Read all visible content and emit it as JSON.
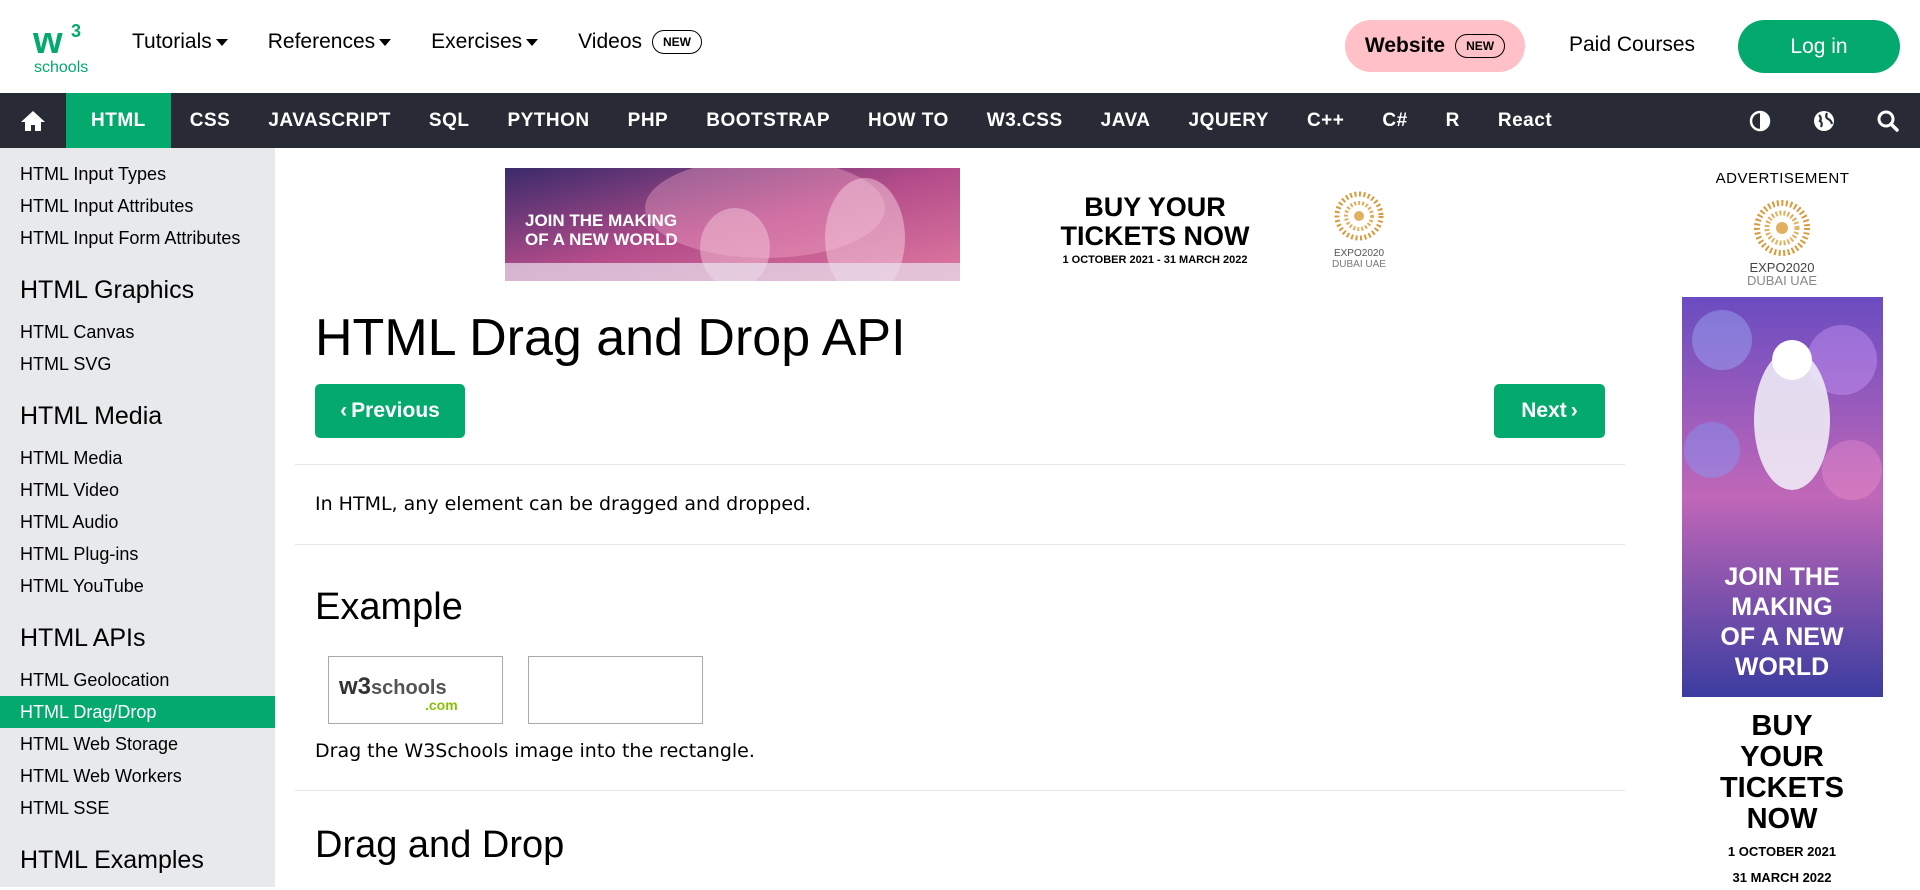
{
  "topnav": {
    "items": [
      {
        "label": "Tutorials"
      },
      {
        "label": "References"
      },
      {
        "label": "Exercises"
      },
      {
        "label": "Videos",
        "badge": "NEW"
      }
    ],
    "website": {
      "label": "Website",
      "badge": "NEW"
    },
    "paid_courses": "Paid Courses",
    "login": "Log in",
    "logo_text": "schools"
  },
  "darknav": {
    "tabs": [
      "HTML",
      "CSS",
      "JAVASCRIPT",
      "SQL",
      "PYTHON",
      "PHP",
      "BOOTSTRAP",
      "HOW TO",
      "W3.CSS",
      "JAVA",
      "JQUERY",
      "C++",
      "C#",
      "R",
      "React"
    ],
    "active": "HTML"
  },
  "sidebar": {
    "links_top": [
      "HTML Input Types",
      "HTML Input Attributes",
      "HTML Input Form Attributes"
    ],
    "sections": [
      {
        "heading": "HTML Graphics",
        "links": [
          "HTML Canvas",
          "HTML SVG"
        ]
      },
      {
        "heading": "HTML Media",
        "links": [
          "HTML Media",
          "HTML Video",
          "HTML Audio",
          "HTML Plug-ins",
          "HTML YouTube"
        ]
      },
      {
        "heading": "HTML APIs",
        "links": [
          "HTML Geolocation",
          "HTML Drag/Drop",
          "HTML Web Storage",
          "HTML Web Workers",
          "HTML SSE"
        ]
      },
      {
        "heading": "HTML Examples",
        "links": []
      }
    ],
    "active_link": "HTML Drag/Drop"
  },
  "banner": {
    "left_text": "JOIN THE MAKING OF A NEW WORLD",
    "headline": "BUY YOUR TICKETS NOW",
    "dates": "1 OCTOBER 2021 - 31 MARCH 2022",
    "expo": "EXPO2020",
    "expo_sub": "DUBAI UAE"
  },
  "main": {
    "title": "HTML Drag and Drop API",
    "prev": "Previous",
    "next": "Next",
    "intro": "In HTML, any element can be dragged and dropped.",
    "example_heading": "Example",
    "drag_caption": "Drag the W3Schools image into the rectangle.",
    "dnd_heading": "Drag and Drop",
    "w3_logo_w3": "w3",
    "w3_logo_schools": "schools",
    "w3_logo_com": ".com"
  },
  "right_ad": {
    "label": "ADVERTISEMENT",
    "expo": "EXPO2020",
    "expo_sub": "DUBAI UAE",
    "join": "JOIN THE MAKING OF A NEW WORLD",
    "buy": "BUY YOUR TICKETS NOW",
    "date1": "1 OCTOBER 2021",
    "date2": "31 MARCH 2022"
  },
  "colors": {
    "accent": "#04aa6d",
    "navbar": "#282a35",
    "sidebar": "#e7e9eb",
    "website_pill": "#ffc0c7"
  }
}
